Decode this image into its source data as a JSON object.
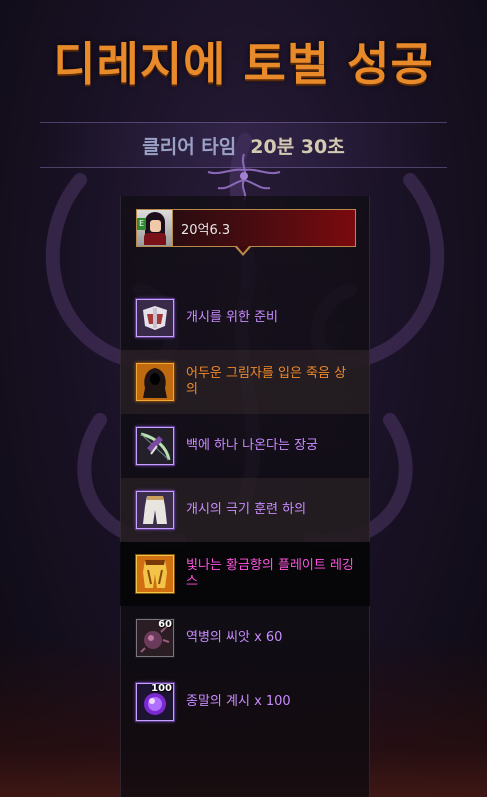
{
  "title": "디레지에 토벌 성공",
  "clear": {
    "label": "클리어 타임",
    "value": "20분 30초"
  },
  "character": {
    "level_tag": "E",
    "value": "20억6.3"
  },
  "items": [
    {
      "name": "개시를 위한 준비",
      "rarity": "rare",
      "icon": "armor-icon",
      "quantity": ""
    },
    {
      "name": "어두운 그림자를 입은 죽음 상의",
      "rarity": "unique",
      "icon": "hooded-robe-icon",
      "quantity": ""
    },
    {
      "name": "백에 하나 나온다는 장궁",
      "rarity": "rare",
      "icon": "longbow-icon",
      "quantity": ""
    },
    {
      "name": "개시의 극기 훈련 하의",
      "rarity": "rare",
      "icon": "pants-icon",
      "quantity": ""
    },
    {
      "name": "빛나는 황금향의 플레이트 레깅스",
      "rarity": "epic",
      "icon": "plate-leggings-icon",
      "quantity": ""
    },
    {
      "name": "역병의 씨앗 x 60",
      "rarity": "material",
      "icon": "plague-seed-icon",
      "quantity": "60"
    },
    {
      "name": "종말의 계시 x 100",
      "rarity": "material",
      "icon": "doom-orb-icon",
      "quantity": "100"
    }
  ],
  "colors": {
    "title": "#e88a2a",
    "rare": "#c88cff",
    "unique": "#f08a2a",
    "epic": "#ff55e0"
  }
}
